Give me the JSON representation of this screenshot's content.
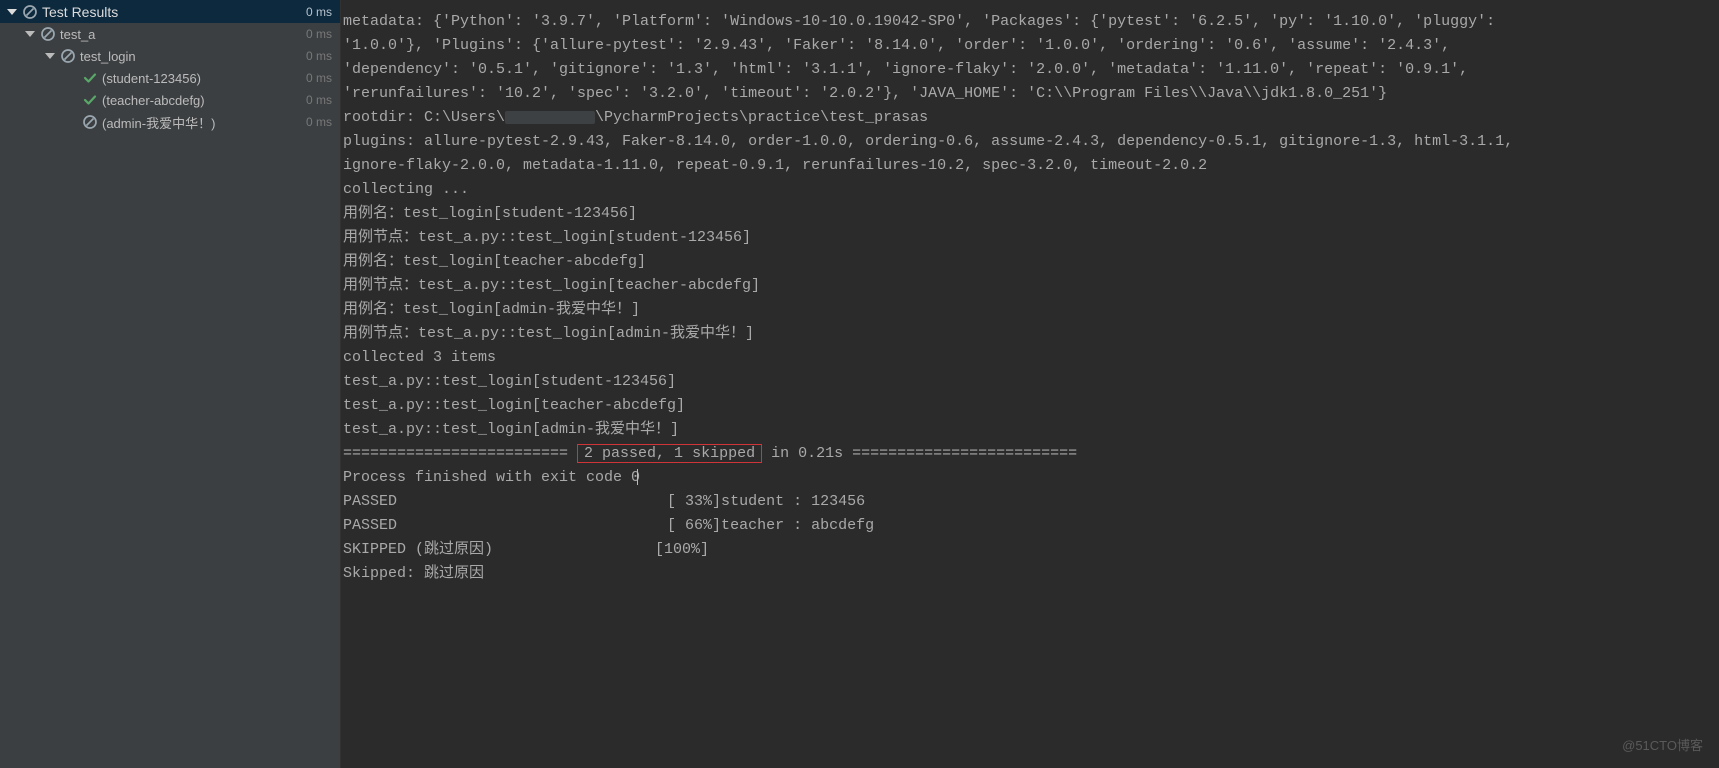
{
  "sidebar": {
    "header": {
      "label": "Test Results",
      "duration": "0 ms",
      "status": "skip"
    },
    "items": [
      {
        "label": "test_a",
        "duration": "0 ms",
        "status": "skip",
        "expandable": true,
        "indent": 1
      },
      {
        "label": "test_login",
        "duration": "0 ms",
        "status": "skip",
        "expandable": true,
        "indent": 2
      },
      {
        "label": "(student-123456)",
        "duration": "0 ms",
        "status": "pass",
        "expandable": false,
        "indent": 3
      },
      {
        "label": "(teacher-abcdefg)",
        "duration": "0 ms",
        "status": "pass",
        "expandable": false,
        "indent": 3
      },
      {
        "label": "(admin-我爱中华！)",
        "duration": "0 ms",
        "status": "skip",
        "expandable": false,
        "indent": 3
      }
    ]
  },
  "console": {
    "line1": "metadata: {'Python': '3.9.7', 'Platform': 'Windows-10-10.0.19042-SP0', 'Packages': {'pytest': '6.2.5', 'py': '1.10.0', 'pluggy': ",
    "line2": "'1.0.0'}, 'Plugins': {'allure-pytest': '2.9.43', 'Faker': '8.14.0', 'order': '1.0.0', 'ordering': '0.6', 'assume': '2.4.3', ",
    "line3": "'dependency': '0.5.1', 'gitignore': '1.3', 'html': '3.1.1', 'ignore-flaky': '2.0.0', 'metadata': '1.11.0', 'repeat': '0.9.1', ",
    "line4": "'rerunfailures': '10.2', 'spec': '3.2.0', 'timeout': '2.0.2'}, 'JAVA_HOME': 'C:\\\\Program Files\\\\Java\\\\jdk1.8.0_251'}",
    "line5a": "rootdir: C:\\Users\\",
    "line5b": "\\PycharmProjects\\practice\\test_prasas",
    "line6": "plugins: allure-pytest-2.9.43, Faker-8.14.0, order-1.0.0, ordering-0.6, assume-2.4.3, dependency-0.5.1, gitignore-1.3, html-3.1.1, ",
    "line7": "ignore-flaky-2.0.0, metadata-1.11.0, repeat-0.9.1, rerunfailures-10.2, spec-3.2.0, timeout-2.0.2",
    "line8": "collecting ...",
    "line9": "用例名：test_login[student-123456]",
    "line10": "用例节点：test_a.py::test_login[student-123456]",
    "line11": "",
    "line12": "用例名：test_login[teacher-abcdefg]",
    "line13": "用例节点：test_a.py::test_login[teacher-abcdefg]",
    "line14": "",
    "line15": "用例名：test_login[admin-我爱中华！]",
    "line16": "用例节点：test_a.py::test_login[admin-我爱中华！]",
    "line17": "collected 3 items",
    "line18": "",
    "line19": "test_a.py::test_login[student-123456]",
    "line20": "test_a.py::test_login[teacher-abcdefg]",
    "line21": "test_a.py::test_login[admin-我爱中华！]",
    "line22": "",
    "summary_left": "========================= ",
    "summary_highlight": "2 passed, 1 skipped",
    "summary_right": " in 0.21s =========================",
    "line24": "",
    "line25": "Process finished with exit code 0",
    "line26": "PASSED                              [ 33%]student : 123456",
    "line27": "PASSED                              [ 66%]teacher : abcdefg",
    "line28": "SKIPPED (跳过原因)                  [100%]",
    "line29": "Skipped: 跳过原因"
  },
  "watermark": "@51CTO博客"
}
